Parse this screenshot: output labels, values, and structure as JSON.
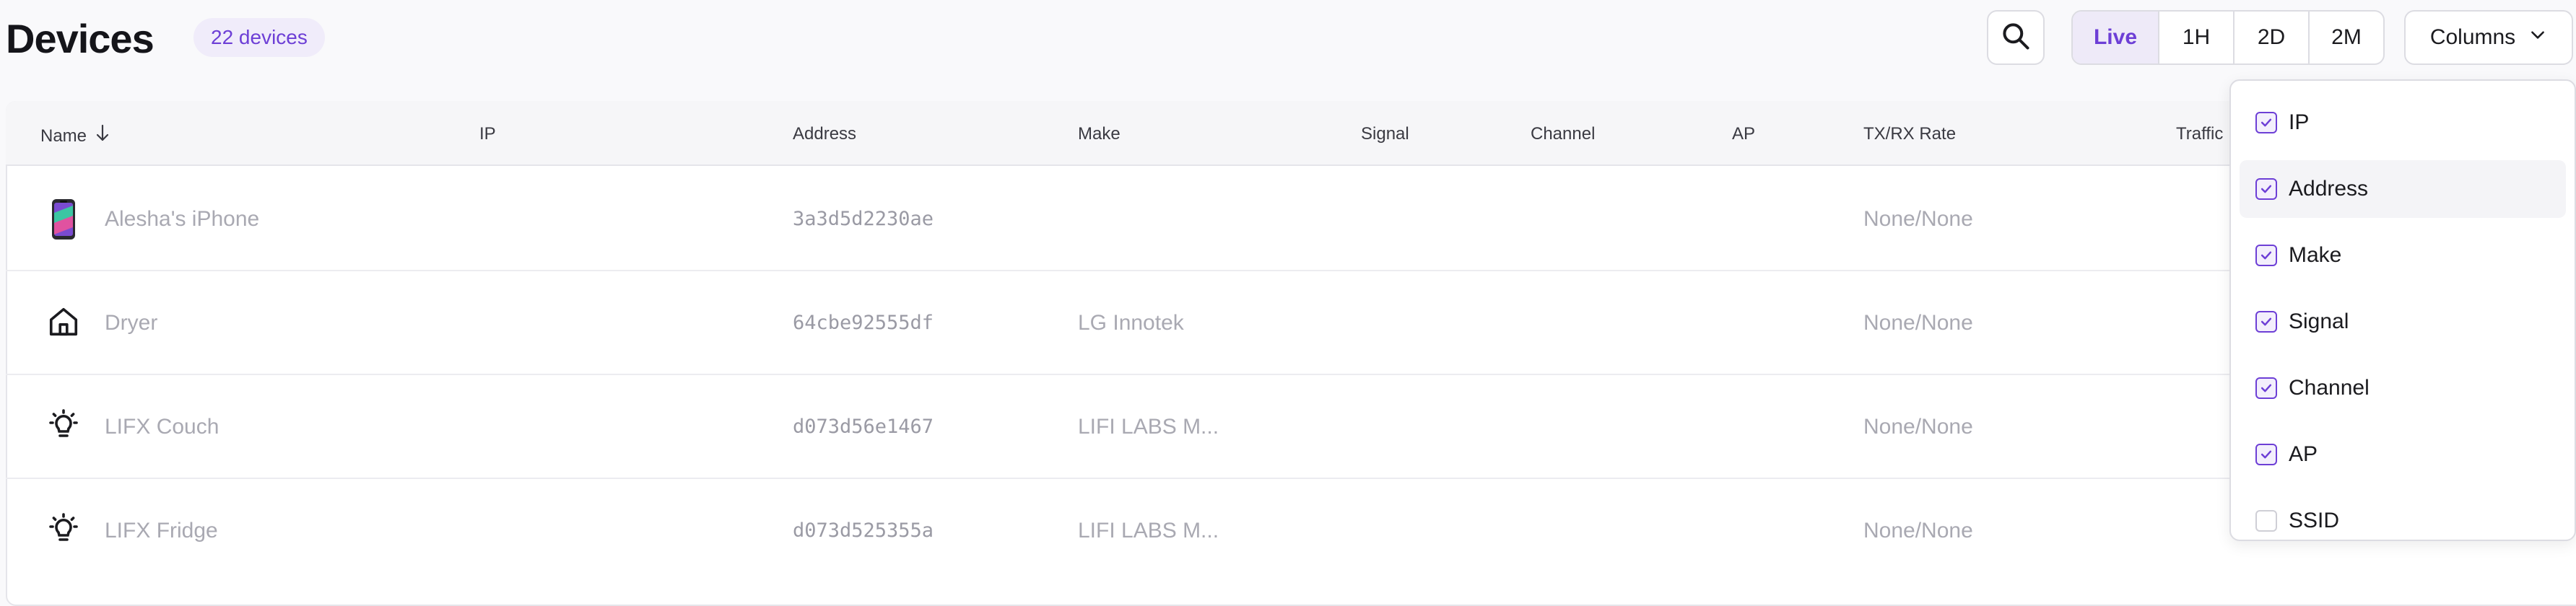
{
  "header": {
    "title": "Devices",
    "device_count": "22 devices",
    "search_icon": "search-icon",
    "time_ranges": [
      "Live",
      "1H",
      "2D",
      "2M"
    ],
    "active_range": "Live",
    "columns_label": "Columns",
    "columns_icon": "chevron-down-icon"
  },
  "table": {
    "columns": [
      "Name",
      "IP",
      "Address",
      "Make",
      "Signal",
      "Channel",
      "AP",
      "TX/RX Rate",
      "Traffic"
    ],
    "sort": {
      "column": "Name",
      "direction": "ascending",
      "icon": "arrow-down-icon"
    },
    "rows": [
      {
        "icon": "smartphone-icon",
        "name": "Alesha's iPhone",
        "ip": "",
        "address": "3a3d5d2230ae",
        "make": "",
        "signal": "",
        "channel": "",
        "ap": "",
        "txrx": "None/None"
      },
      {
        "icon": "home-icon",
        "name": "Dryer",
        "ip": "",
        "address": "64cbe92555df",
        "make": "LG Innotek",
        "signal": "",
        "channel": "",
        "ap": "",
        "txrx": "None/None"
      },
      {
        "icon": "lightbulb-icon",
        "name": "LIFX Couch",
        "ip": "",
        "address": "d073d56e1467",
        "make": "LIFI LABS M...",
        "signal": "",
        "channel": "",
        "ap": "",
        "txrx": "None/None"
      },
      {
        "icon": "lightbulb-icon",
        "name": "LIFX Fridge",
        "ip": "",
        "address": "d073d525355a",
        "make": "LIFI LABS M...",
        "signal": "",
        "channel": "",
        "ap": "",
        "txrx": "None/None"
      }
    ]
  },
  "columns_menu": {
    "options": [
      {
        "label": "IP",
        "checked": true
      },
      {
        "label": "Address",
        "checked": true
      },
      {
        "label": "Make",
        "checked": true
      },
      {
        "label": "Signal",
        "checked": true
      },
      {
        "label": "Channel",
        "checked": true
      },
      {
        "label": "AP",
        "checked": true
      },
      {
        "label": "SSID",
        "checked": false
      }
    ],
    "hovered": "Address"
  },
  "colors": {
    "accent": "#6d3fd6",
    "accent_bg": "#eeeaf8",
    "muted_text": "#a9a9b2"
  }
}
